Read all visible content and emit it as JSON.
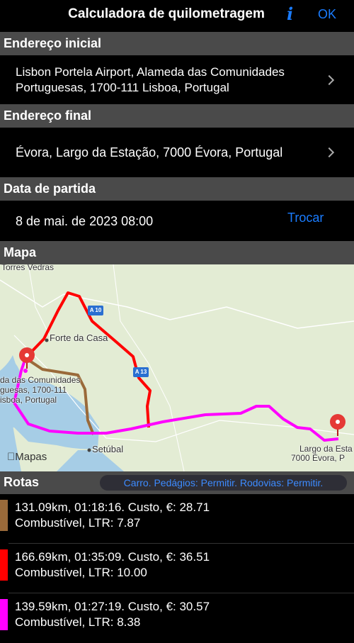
{
  "nav": {
    "title": "Calculadora de quilometragem",
    "info": "i",
    "ok": "OK"
  },
  "start": {
    "header": "Endereço inicial",
    "line1": "Lisbon Portela Airport, Alameda das Comunidades",
    "line2": "Portuguesas, 1700-111 Lisboa, Portugal"
  },
  "end": {
    "header": "Endereço final",
    "address": "Évora, Largo da Estação, 7000 Évora, Portugal"
  },
  "departure": {
    "header": "Data de partida",
    "datetime": "8 de mai. de 2023 08:00",
    "change": "Trocar"
  },
  "map": {
    "header": "Mapa",
    "labels": {
      "torres": "Torres Vedras",
      "forte": "Forte da Casa",
      "origin1": "da das Comunidades",
      "origin2": "guesas, 1700-111",
      "origin3": "isboa, Portugal",
      "setubal": "Setúbal",
      "dest1": "Largo da Esta",
      "dest2": "7000 Évora, P",
      "brand": "Mapas",
      "a10": "A 10",
      "a13": "A 13"
    }
  },
  "routes": {
    "header": "Rotas",
    "options": "Carro. Pedágios: Permitir. Rodovias: Permitir.",
    "items": [
      {
        "color": "#9a6a3a",
        "line1": "131.09km, 01:18:16. Custo, €: 28.71",
        "line2": "Combustível, LTR: 7.87"
      },
      {
        "color": "#ff0000",
        "line1": "166.69km, 01:35:09. Custo, €: 36.51",
        "line2": "Combustível, LTR: 10.00"
      },
      {
        "color": "#ff00ff",
        "line1": "139.59km, 01:27:19. Custo, €: 30.57",
        "line2": "Combustível, LTR: 8.38"
      }
    ]
  }
}
